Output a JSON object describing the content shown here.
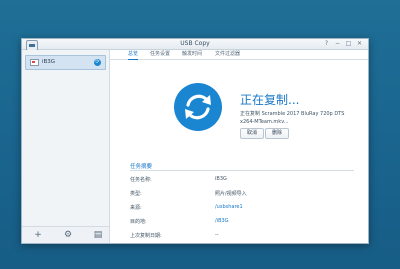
{
  "window": {
    "title": "USB Copy",
    "controls": {
      "help": "?",
      "minimize": "−",
      "maximize": "□",
      "close": "✕"
    }
  },
  "sidebar": {
    "items": [
      {
        "label": "iB3G",
        "icon": "usb-drive-icon",
        "status_icon": "sync-icon"
      }
    ],
    "toolbar": [
      {
        "label": "+",
        "icon": "add-icon"
      },
      {
        "label": "⚙",
        "icon": "gear-icon"
      },
      {
        "label": "▤",
        "icon": "log-icon"
      }
    ]
  },
  "tabs": [
    "总览",
    "任务设置",
    "触发时间",
    "文件过滤器"
  ],
  "active_tab": "总览",
  "status": {
    "title": "正在复制...",
    "detail": "正在复制 Scramble 2017 BluRay 720p DTS x264-MTeam.mkv..."
  },
  "buttons": {
    "cancel": "取消",
    "delete": "删除"
  },
  "summary": {
    "title": "任务摘要",
    "rows": [
      {
        "label": "任务名称:",
        "value": "iB3G"
      },
      {
        "label": "类型:",
        "value": "照片/视频导入"
      },
      {
        "label": "来源:",
        "value": "/usbshare1"
      },
      {
        "label": "目的地:",
        "value": "/iB3G"
      },
      {
        "label": "上次复制日期:",
        "value": "--"
      }
    ]
  },
  "colors": {
    "accent": "#1a77c8",
    "icon_blue": "#1a86d2",
    "desktop": "#1a6690"
  }
}
